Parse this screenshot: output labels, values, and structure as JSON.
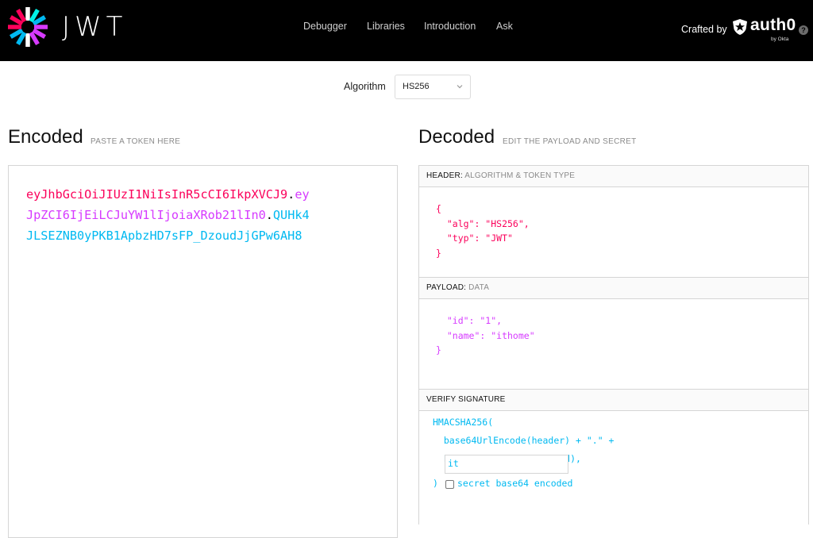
{
  "header": {
    "wordmark": "JWT",
    "nav": [
      "Debugger",
      "Libraries",
      "Introduction",
      "Ask"
    ],
    "crafted_by": "Crafted by",
    "brand": "auth0",
    "brand_sub": "by Okta",
    "help_glyph": "?"
  },
  "algorithm": {
    "label": "Algorithm",
    "selected": "HS256"
  },
  "encoded": {
    "title": "Encoded",
    "subtitle": "PASTE A TOKEN HERE",
    "lines": [
      {
        "red": "eyJhbGciOiJIUzI1NiIsInR5cCI6IkpXVCJ9",
        "dot": ".",
        "purple": "ey"
      },
      {
        "purple": "JpZCI6IjEiLCJuYW1lIjoiaXRob21lIn0",
        "dot": ".",
        "blue": "QUHk4"
      },
      {
        "blue": "JLSEZNB0yPKB1ApbzHD7sFP_DzoudJjGPw6AH8"
      }
    ]
  },
  "decoded": {
    "title": "Decoded",
    "subtitle": "EDIT THE PAYLOAD AND SECRET",
    "header_panel": {
      "title": "HEADER:",
      "subtitle": "ALGORITHM & TOKEN TYPE",
      "code": "{\n  \"alg\": \"HS256\",\n  \"typ\": \"JWT\"\n}"
    },
    "payload_panel": {
      "title": "PAYLOAD:",
      "subtitle": "DATA",
      "code": "  \"id\": \"1\",\n  \"name\": \"ithome\"\n}"
    },
    "signature_panel": {
      "title": "VERIFY SIGNATURE",
      "code": "HMACSHA256(\n  base64UrlEncode(header) + \".\" +\n  base64UrlEncode(payload),",
      "secret_value": "it",
      "close_paren": ")",
      "base64_label": "secret base64 encoded",
      "base64_checked": false
    }
  },
  "colors": {
    "header_red": "#fb015b",
    "payload_purple": "#d63aff",
    "signature_blue": "#00b9f1",
    "topbar_bg": "#000000"
  },
  "icons": {
    "logo": "jwt-starburst-icon",
    "select": "chevron-down-icon",
    "brand": "auth0-shield-icon",
    "help": "help-circle-icon"
  }
}
